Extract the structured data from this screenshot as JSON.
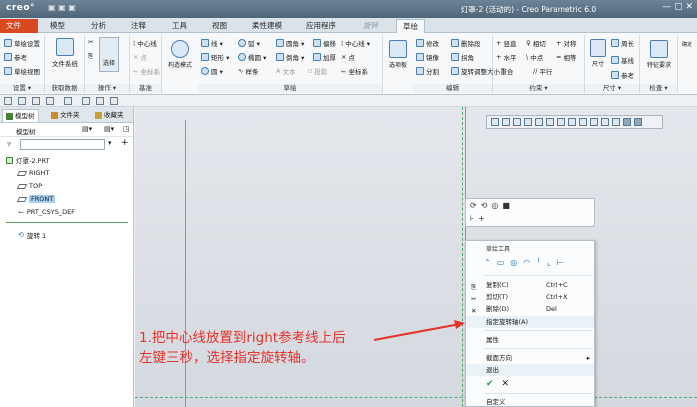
{
  "titlebar": {
    "logo": "creo°",
    "window_title": "灯罩-2 (活动的) - Creo Parametric 6.0",
    "controls": "— ▢ ✕"
  },
  "tabs": [
    {
      "label": "文件"
    },
    {
      "label": "模型"
    },
    {
      "label": "分析"
    },
    {
      "label": "注释"
    },
    {
      "label": "工具"
    },
    {
      "label": "视图"
    },
    {
      "label": "柔性建模"
    },
    {
      "label": "应用程序"
    },
    {
      "label": "旋转"
    },
    {
      "label": "草绘"
    }
  ],
  "ribbon": {
    "setup": {
      "items": [
        "草绘设置",
        "参考",
        "草绘视图"
      ],
      "label": "设置 ▾"
    },
    "get_data": {
      "items": [
        "文件系统"
      ],
      "label": "获取数据"
    },
    "operations": {
      "items": [
        "选择"
      ],
      "label": "操作 ▾"
    },
    "datum": {
      "items": [
        "中心线",
        "点",
        "坐标系"
      ],
      "label": "基准"
    },
    "construction": {
      "items": [
        "构造模式"
      ]
    },
    "sketch": {
      "items": [
        "线 ▾",
        "弧 ▾",
        "圆角 ▾",
        "偏移",
        "中心线 ▾",
        "矩形 ▾",
        "椭圆 ▾",
        "倒角 ▾",
        "加厚",
        "点",
        "圆 ▾",
        "样条",
        "文本",
        "投影",
        "坐标系"
      ],
      "label": "草绘"
    },
    "palette": {
      "items": [
        "选项板"
      ]
    },
    "editing": {
      "items": [
        "修改",
        "删除段",
        "镜像",
        "拐角",
        "分割",
        "旋转调整大小"
      ],
      "label": "编辑"
    },
    "constraints": {
      "items": [
        "竖直",
        "相切",
        "对称",
        "水平",
        "中点",
        "相等",
        "重合",
        "平行"
      ],
      "label": "约束 ▾"
    },
    "dimension": {
      "items": [
        "尺寸",
        "周长",
        "基线",
        "参考"
      ],
      "label": "尺寸 ▾"
    },
    "inspect": {
      "items": [
        "特征要求"
      ],
      "label": "检查 ▾"
    },
    "close": {
      "items": [
        "确定",
        "取消"
      ]
    }
  },
  "panel": {
    "tabs": [
      "模型树",
      "文件夹",
      "收藏夹"
    ],
    "header": "模型树",
    "search_placeholder": "",
    "tree": [
      {
        "label": "灯罩-2.PRT"
      },
      {
        "label": "RIGHT"
      },
      {
        "label": "TOP"
      },
      {
        "label": "FRONT"
      },
      {
        "label": "PRT_CSYS_DEF"
      },
      {
        "label": "旋转 1"
      }
    ]
  },
  "context_menu": {
    "header": "草绘工具",
    "items": [
      {
        "label": "复制(C)",
        "shortcut": "Ctrl+C"
      },
      {
        "label": "剪切(T)",
        "shortcut": "Ctrl+X"
      },
      {
        "label": "删除(D)",
        "shortcut": "Del"
      },
      {
        "label": "指定旋转轴(A)",
        "shortcut": ""
      },
      {
        "label": "属性",
        "shortcut": ""
      },
      {
        "label": "截面方向",
        "shortcut": ""
      },
      {
        "label": "退出",
        "shortcut": ""
      },
      {
        "label": "自定义",
        "shortcut": ""
      }
    ],
    "ok": "✔",
    "cancel": "✕"
  },
  "annotation": {
    "line1": "1.把中心线放置到right参考线上后",
    "line2": "左键三秒，选择指定旋转轴。",
    "color": "#e5322a"
  }
}
